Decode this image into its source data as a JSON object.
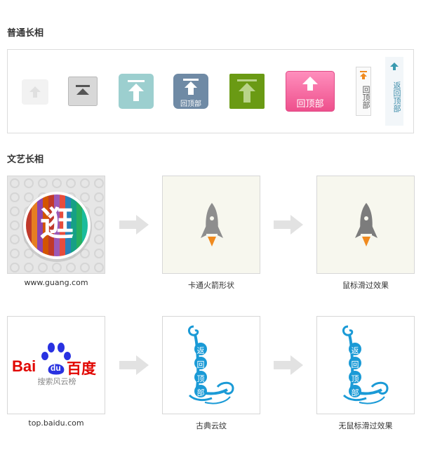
{
  "sections": {
    "normal_title": "普通长相",
    "artistic_title": "文艺长相"
  },
  "buttons": {
    "green_blue_label": "回顶部",
    "pink_label": "回顶部",
    "tall1_label": "回顶部",
    "tall2_label": "返回顶部"
  },
  "tiles": {
    "guang_logo_text": "逛",
    "guang_caption": "www.guang.com",
    "rocket_caption": "卡通火箭形状",
    "rocket_hover_caption": "鼠标滑过效果",
    "baidu_logo_text": "Bai",
    "baidu_logo_du": "du",
    "baidu_logo_cn": "百度",
    "baidu_subtitle": "搜索风云榜",
    "baidu_caption": "top.baidu.com",
    "cloud_caption": "古典云纹",
    "cloud_nohover_caption": "无鼠标滑过效果",
    "cloud_chars": [
      "返",
      "回",
      "顶",
      "部"
    ]
  },
  "colors": {
    "teal": "#9ccfcf",
    "slate": "#6f8aa5",
    "green": "#6a9a14",
    "pink": "#f56aa0",
    "rocket_flame": "#f08a1e",
    "cloud_blue": "#1a9ad6",
    "baidu_red": "#e10601",
    "baidu_blue": "#2932e1"
  }
}
